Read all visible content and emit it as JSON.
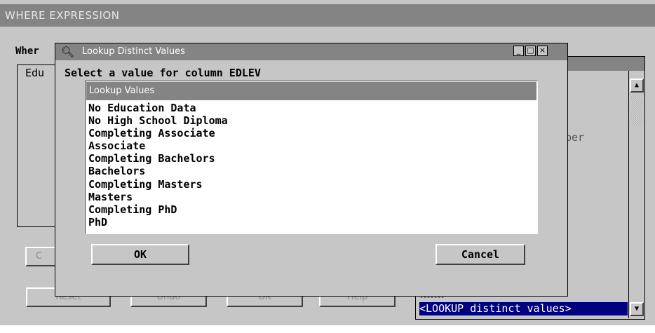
{
  "main": {
    "title": "WHERE EXPRESSION",
    "where_label": "Wher",
    "group_label": "Edu",
    "right_list_fragment": "ber",
    "lookup_item": "<LOOKUP distinct values>",
    "buttons": {
      "c": "C",
      "reset": "Reset",
      "undo": "Undo",
      "ok": "OK",
      "help": "Help"
    }
  },
  "dialog": {
    "title": "Lookup Distinct Values",
    "prompt": "Select a value for column EDLEV",
    "list_header": "Lookup Values",
    "values": [
      "No Education Data",
      "No High School Diploma",
      "Completing Associate",
      "Associate",
      "Completing Bachelors",
      "Bachelors",
      "Completing Masters",
      "Masters",
      "Completing PhD",
      "PhD"
    ],
    "ok_label": "OK",
    "cancel_label": "Cancel",
    "window_buttons": {
      "minimize": "_",
      "maximize": "□",
      "close": "×"
    }
  },
  "icons": {
    "dialog": "magnifier-icon",
    "scroll_up": "scroll-up-arrow-icon",
    "scroll_down": "scroll-down-arrow-icon"
  },
  "colors": {
    "title_bar": "#848484",
    "face": "#c6c6c6",
    "selection": "#000080"
  }
}
